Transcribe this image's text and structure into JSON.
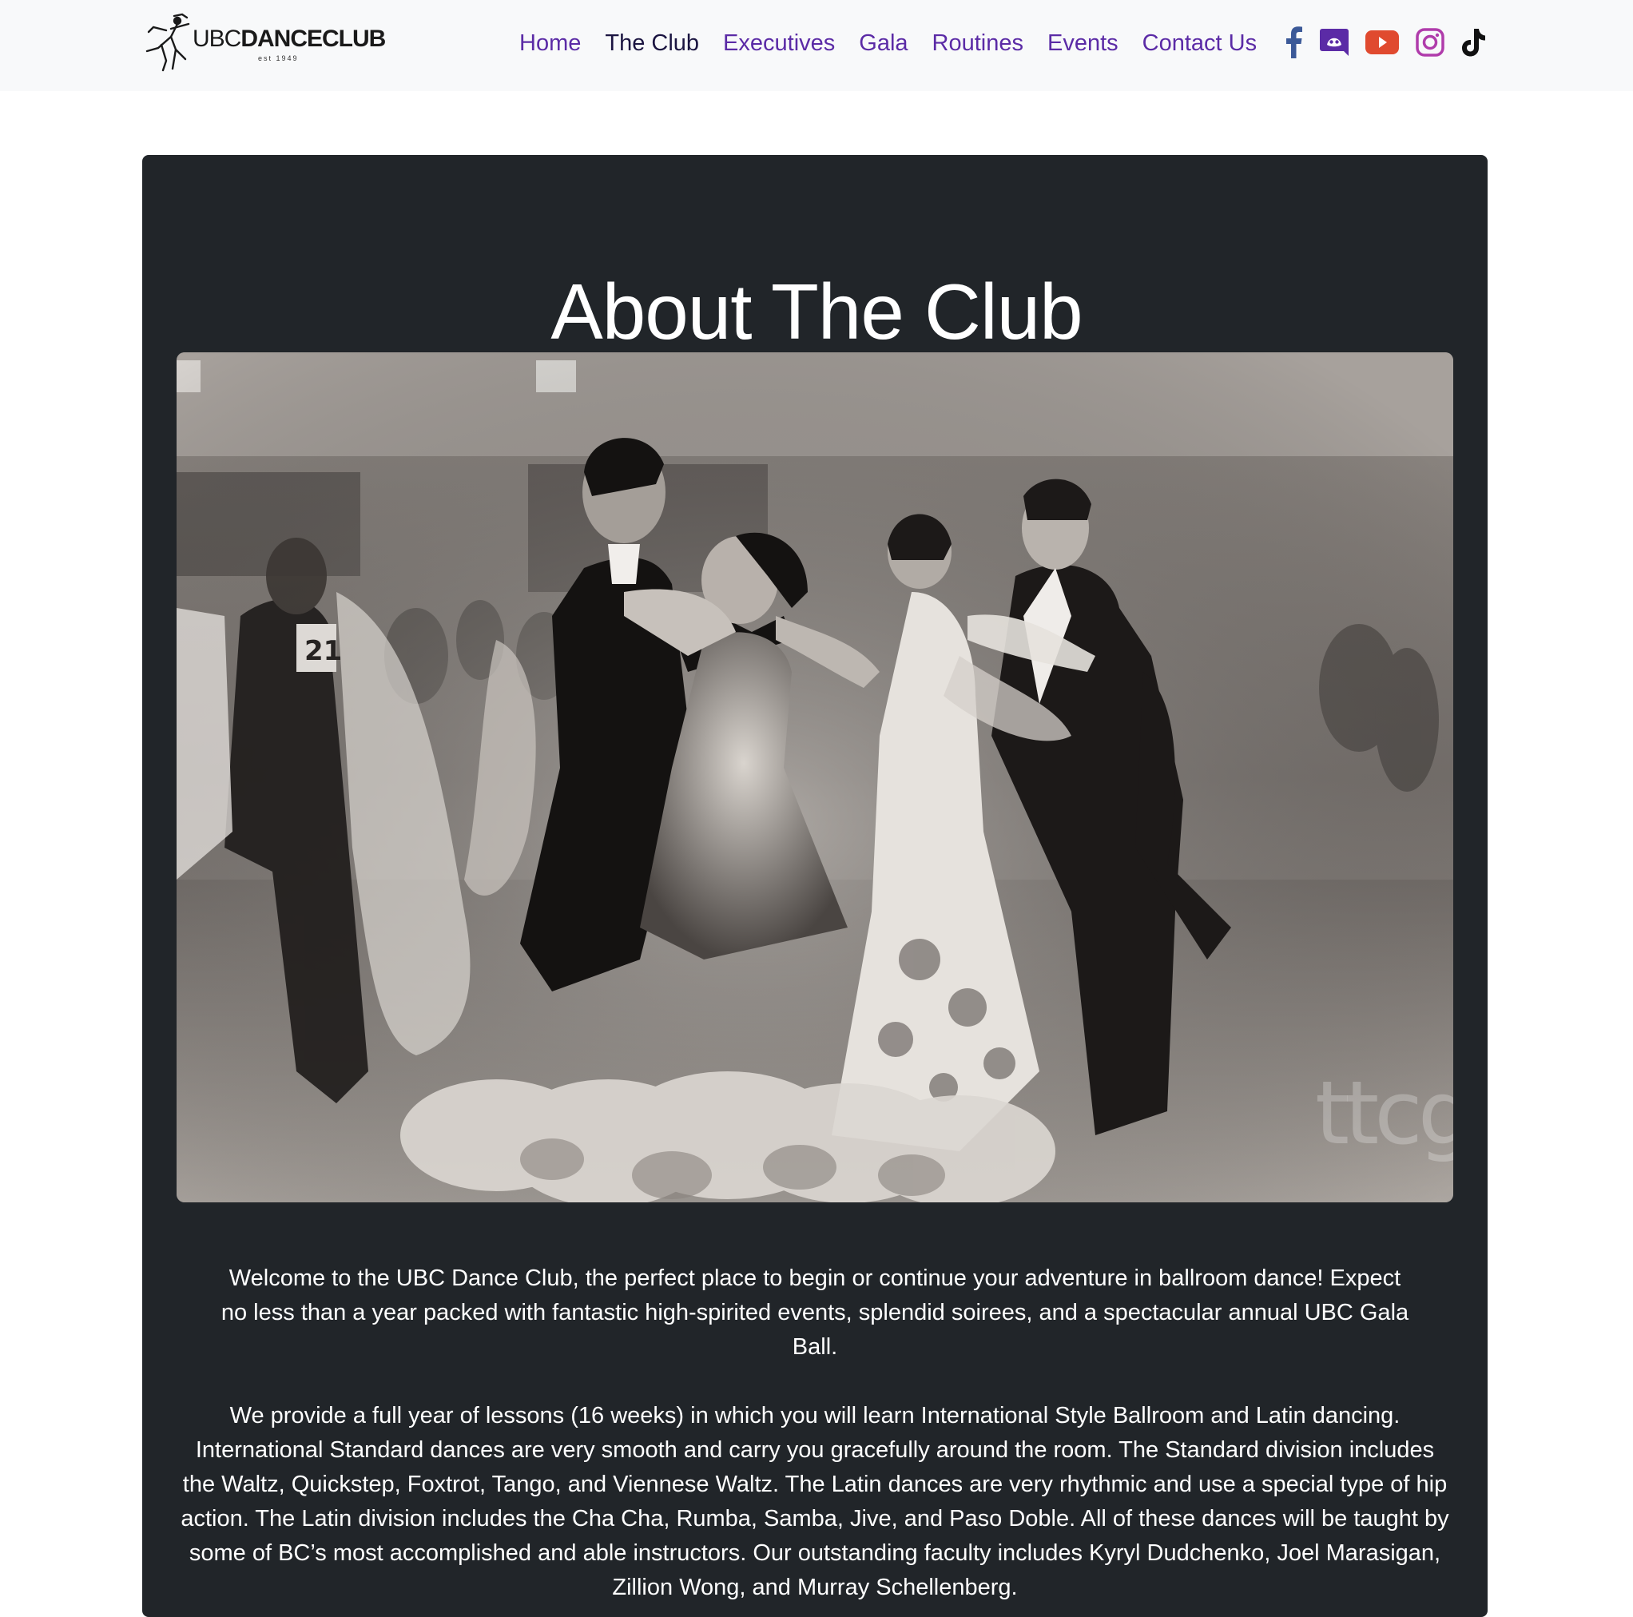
{
  "logo": {
    "ubc": "UBC",
    "dance": "DANCECLUB",
    "est": "est 1949"
  },
  "nav": {
    "links": [
      "Home",
      "The Club",
      "Executives",
      "Gala",
      "Routines",
      "Events",
      "Contact Us"
    ],
    "active": "The Club"
  },
  "social": {
    "icons": [
      "facebook-icon",
      "discord-icon",
      "youtube-icon",
      "instagram-icon",
      "tiktok-icon"
    ],
    "colors": {
      "facebook": "#3b5998",
      "discord": "#5b2ba6",
      "youtube": "#e04a2f",
      "instagram": "#b03cab",
      "tiktok": "#111111"
    }
  },
  "colors": {
    "nav_link": "#5b2ba6",
    "nav_active": "#1b1541",
    "card_bg": "#212529"
  },
  "main": {
    "title": "About The Club",
    "photo_watermark": "ttcg",
    "bib_number": "21",
    "paragraph1": "Welcome to the UBC Dance Club, the perfect place to begin or continue your adventure in ballroom dance! Expect no less than a year packed with fantastic high-spirited events, splendid soirees, and a spectacular annual UBC Gala Ball.",
    "paragraph2": "We provide a full year of lessons (16 weeks) in which you will learn International Style Ballroom and Latin dancing. International Standard dances are very smooth and carry you gracefully around the room. The Standard division includes the Waltz, Quickstep, Foxtrot, Tango, and Viennese Waltz. The Latin dances are very rhythmic and use a special type of hip action. The Latin division includes the Cha Cha, Rumba, Samba, Jive, and Paso Doble. All of these dances will be taught by some of BC’s most accomplished and able instructors. Our outstanding faculty includes Kyryl Dudchenko, Joel Marasigan, Zillion Wong, and Murray Schellenberg."
  }
}
